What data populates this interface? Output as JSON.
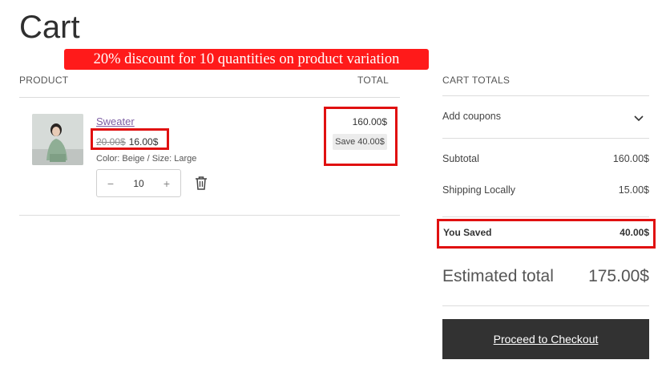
{
  "page": {
    "title": "Cart"
  },
  "annotation": {
    "text": "20% discount for 10 quantities on product variation"
  },
  "table": {
    "product_header": "PRODUCT",
    "total_header": "TOTAL"
  },
  "item": {
    "name": "Sweater",
    "regular_price": "20.00$",
    "sale_price": "16.00$",
    "variation": "Color: Beige / Size: Large",
    "quantity": "10",
    "qty_minus": "−",
    "qty_plus": "+",
    "line_total": "160.00$",
    "save_badge": "Save 40.00$"
  },
  "totals": {
    "header": "CART TOTALS",
    "coupons_label": "Add coupons",
    "subtotal_label": "Subtotal",
    "subtotal_value": "160.00$",
    "shipping_label": "Shipping Locally",
    "shipping_value": "15.00$",
    "saved_label": "You Saved",
    "saved_value": "40.00$",
    "estimated_label": "Estimated total",
    "estimated_value": "175.00$"
  },
  "checkout": {
    "label": "Proceed to Checkout"
  },
  "colors": {
    "annotation_red": "#ff1a1a",
    "link_purple": "#7d5ea3",
    "checkout_bg": "#323232"
  },
  "icons": {
    "trash": "trash-icon",
    "chevron": "chevron-down-icon"
  }
}
